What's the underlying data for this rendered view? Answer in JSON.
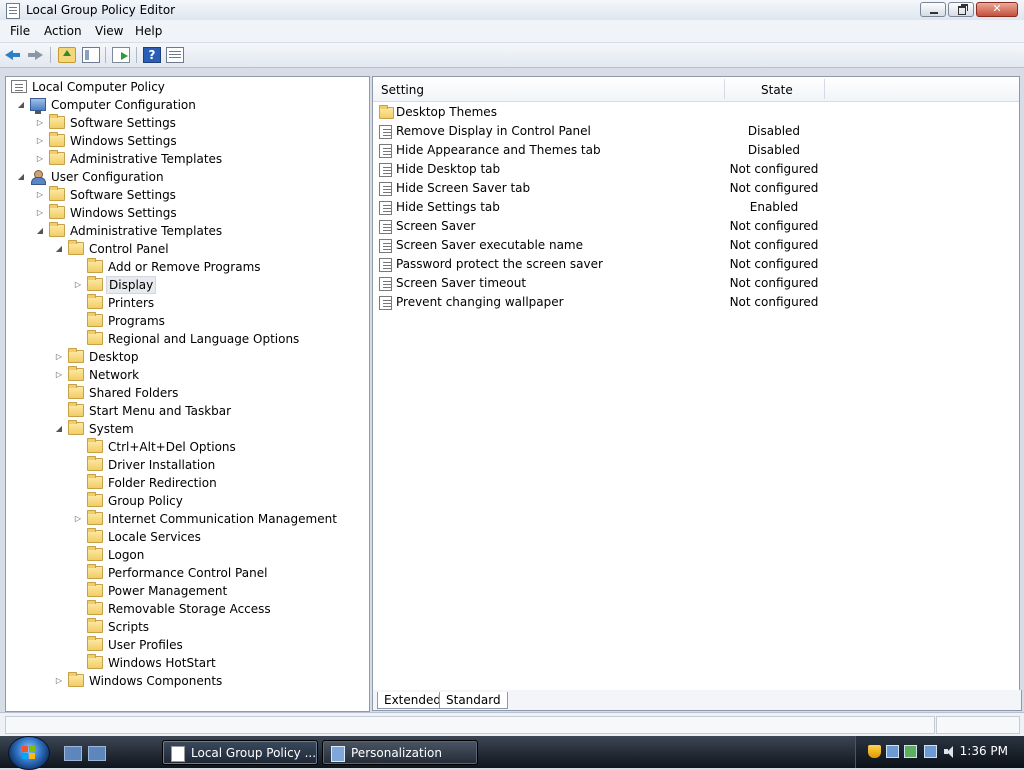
{
  "window": {
    "title": "Local Group Policy Editor"
  },
  "menu": [
    "File",
    "Action",
    "View",
    "Help"
  ],
  "tree": {
    "items": [
      {
        "label": "Local Computer Policy",
        "level": 0,
        "icon": "policy-icon",
        "toggle": ""
      },
      {
        "label": "Computer Configuration",
        "level": 1,
        "icon": "computer-icon",
        "toggle": "expanded"
      },
      {
        "label": "Software Settings",
        "level": 2,
        "icon": "folder-icon",
        "toggle": "collapsed"
      },
      {
        "label": "Windows Settings",
        "level": 2,
        "icon": "folder-icon",
        "toggle": "collapsed"
      },
      {
        "label": "Administrative Templates",
        "level": 2,
        "icon": "folder-icon",
        "toggle": "collapsed"
      },
      {
        "label": "User Configuration",
        "level": 1,
        "icon": "user-icon",
        "toggle": "expanded"
      },
      {
        "label": "Software Settings",
        "level": 2,
        "icon": "folder-icon",
        "toggle": "collapsed"
      },
      {
        "label": "Windows Settings",
        "level": 2,
        "icon": "folder-icon",
        "toggle": "collapsed"
      },
      {
        "label": "Administrative Templates",
        "level": 2,
        "icon": "folder-icon",
        "toggle": "expanded"
      },
      {
        "label": "Control Panel",
        "level": 3,
        "icon": "folder-icon",
        "toggle": "expanded"
      },
      {
        "label": "Add or Remove Programs",
        "level": 4,
        "icon": "folder-icon",
        "toggle": ""
      },
      {
        "label": "Display",
        "level": 4,
        "icon": "folder-icon",
        "toggle": "collapsed",
        "selected": true
      },
      {
        "label": "Printers",
        "level": 4,
        "icon": "folder-icon",
        "toggle": ""
      },
      {
        "label": "Programs",
        "level": 4,
        "icon": "folder-icon",
        "toggle": ""
      },
      {
        "label": "Regional and Language Options",
        "level": 4,
        "icon": "folder-icon",
        "toggle": ""
      },
      {
        "label": "Desktop",
        "level": 3,
        "icon": "folder-icon",
        "toggle": "collapsed"
      },
      {
        "label": "Network",
        "level": 3,
        "icon": "folder-icon",
        "toggle": "collapsed"
      },
      {
        "label": "Shared Folders",
        "level": 3,
        "icon": "folder-icon",
        "toggle": ""
      },
      {
        "label": "Start Menu and Taskbar",
        "level": 3,
        "icon": "folder-icon",
        "toggle": ""
      },
      {
        "label": "System",
        "level": 3,
        "icon": "folder-icon",
        "toggle": "expanded"
      },
      {
        "label": "Ctrl+Alt+Del Options",
        "level": 4,
        "icon": "folder-icon",
        "toggle": ""
      },
      {
        "label": "Driver Installation",
        "level": 4,
        "icon": "folder-icon",
        "toggle": ""
      },
      {
        "label": "Folder Redirection",
        "level": 4,
        "icon": "folder-icon",
        "toggle": ""
      },
      {
        "label": "Group Policy",
        "level": 4,
        "icon": "folder-icon",
        "toggle": ""
      },
      {
        "label": "Internet Communication Management",
        "level": 4,
        "icon": "folder-icon",
        "toggle": "collapsed"
      },
      {
        "label": "Locale Services",
        "level": 4,
        "icon": "folder-icon",
        "toggle": ""
      },
      {
        "label": "Logon",
        "level": 4,
        "icon": "folder-icon",
        "toggle": ""
      },
      {
        "label": "Performance Control Panel",
        "level": 4,
        "icon": "folder-icon",
        "toggle": ""
      },
      {
        "label": "Power Management",
        "level": 4,
        "icon": "folder-icon",
        "toggle": ""
      },
      {
        "label": "Removable Storage Access",
        "level": 4,
        "icon": "folder-icon",
        "toggle": ""
      },
      {
        "label": "Scripts",
        "level": 4,
        "icon": "folder-icon",
        "toggle": ""
      },
      {
        "label": "User Profiles",
        "level": 4,
        "icon": "folder-icon",
        "toggle": ""
      },
      {
        "label": "Windows HotStart",
        "level": 4,
        "icon": "folder-icon",
        "toggle": ""
      },
      {
        "label": "Windows Components",
        "level": 3,
        "icon": "folder-icon",
        "toggle": "collapsed"
      }
    ]
  },
  "list": {
    "columns": {
      "setting": "Setting",
      "state": "State"
    },
    "rows": [
      {
        "name": "Desktop Themes",
        "state": "",
        "icon": "folder-icon"
      },
      {
        "name": "Remove Display in Control Panel",
        "state": "Disabled",
        "icon": "policy-icon"
      },
      {
        "name": "Hide Appearance and Themes tab",
        "state": "Disabled",
        "icon": "policy-icon"
      },
      {
        "name": "Hide Desktop tab",
        "state": "Not configured",
        "icon": "policy-icon"
      },
      {
        "name": "Hide Screen Saver tab",
        "state": "Not configured",
        "icon": "policy-icon"
      },
      {
        "name": "Hide Settings tab",
        "state": "Enabled",
        "icon": "policy-icon"
      },
      {
        "name": "Screen Saver",
        "state": "Not configured",
        "icon": "policy-icon"
      },
      {
        "name": "Screen Saver executable name",
        "state": "Not configured",
        "icon": "policy-icon"
      },
      {
        "name": "Password protect the screen saver",
        "state": "Not configured",
        "icon": "policy-icon"
      },
      {
        "name": "Screen Saver timeout",
        "state": "Not configured",
        "icon": "policy-icon"
      },
      {
        "name": "Prevent changing wallpaper",
        "state": "Not configured",
        "icon": "policy-icon"
      }
    ]
  },
  "view_tabs": [
    "Extended",
    "Standard"
  ],
  "taskbar": {
    "buttons": [
      {
        "label": "Local Group Policy ...",
        "active": true
      },
      {
        "label": "Personalization",
        "active": false
      }
    ],
    "clock": "1:36 PM"
  }
}
